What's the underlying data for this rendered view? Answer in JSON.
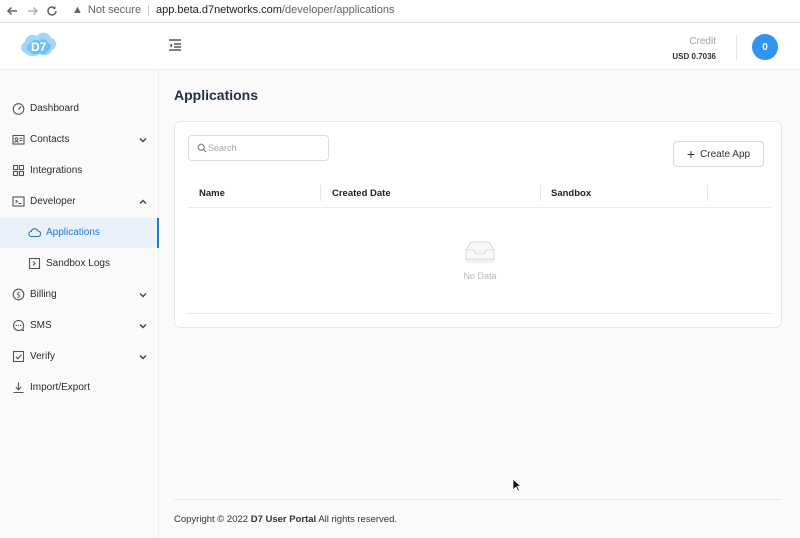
{
  "browser": {
    "security_label": "Not secure",
    "url_host": "app.beta.d7networks.com",
    "url_path": "/developer/applications"
  },
  "header": {
    "logo_text": "D7",
    "credit_label": "Credit",
    "credit_value": "USD 0.7036",
    "avatar_text": "0"
  },
  "sidebar": {
    "items": [
      {
        "label": "Dashboard",
        "icon": "dashboard-icon"
      },
      {
        "label": "Contacts",
        "icon": "contacts-icon",
        "chevron": "down"
      },
      {
        "label": "Integrations",
        "icon": "integrations-icon"
      },
      {
        "label": "Developer",
        "icon": "developer-icon",
        "chevron": "up"
      },
      {
        "label": "Applications",
        "icon": "cloud-icon",
        "active": true
      },
      {
        "label": "Sandbox Logs",
        "icon": "sandbox-icon"
      },
      {
        "label": "Billing",
        "icon": "billing-icon",
        "chevron": "down"
      },
      {
        "label": "SMS",
        "icon": "sms-icon",
        "chevron": "down"
      },
      {
        "label": "Verify",
        "icon": "verify-icon",
        "chevron": "down"
      },
      {
        "label": "Import/Export",
        "icon": "download-icon"
      }
    ]
  },
  "main": {
    "title": "Applications",
    "search_placeholder": "Search",
    "create_label": "Create App",
    "columns": [
      "Name",
      "Created Date",
      "Sandbox"
    ],
    "empty_text": "No Data"
  },
  "footer": {
    "prefix": "Copyright © 2022 ",
    "brand": "D7 User Portal",
    "suffix": " All rights reserved."
  },
  "colors": {
    "accent": "#1f78d1",
    "avatar": "#2f95f0",
    "title": "#253142"
  }
}
